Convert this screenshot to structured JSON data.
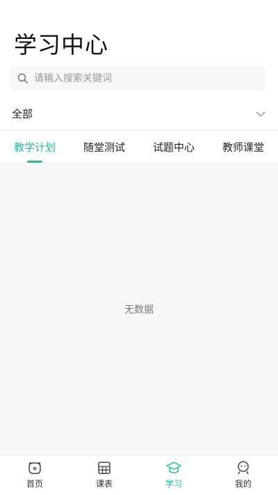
{
  "header": {
    "title": "学习中心"
  },
  "search": {
    "placeholder": "请输入搜索关键词",
    "value": ""
  },
  "filter": {
    "label": "全部"
  },
  "tabs": [
    {
      "label": "教学计划",
      "active": true
    },
    {
      "label": "随堂测试",
      "active": false
    },
    {
      "label": "试题中心",
      "active": false
    },
    {
      "label": "教师课堂",
      "active": false
    }
  ],
  "content": {
    "empty_text": "无数据"
  },
  "tabbar": [
    {
      "label": "首页",
      "icon": "home-icon"
    },
    {
      "label": "课表",
      "icon": "calendar-icon"
    },
    {
      "label": "学习",
      "icon": "graduation-cap-icon",
      "active": true
    },
    {
      "label": "我的",
      "icon": "user-icon"
    }
  ],
  "colors": {
    "accent": "#19c0a0",
    "content_bg": "#f7f7f9"
  }
}
